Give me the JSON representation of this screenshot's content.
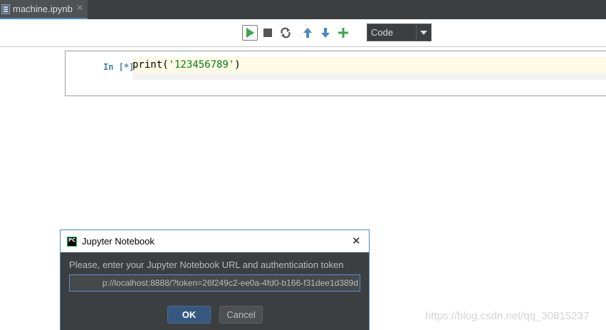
{
  "tab": {
    "title": "machine.ipynb",
    "close_glyph": "✕",
    "icon": "notebook-file-icon"
  },
  "toolbar": {
    "buttons": [
      {
        "name": "run-cell-button",
        "icon": "play-icon",
        "color": "#3fa34d"
      },
      {
        "name": "interrupt-button",
        "icon": "stop-icon",
        "color": "#555555"
      },
      {
        "name": "restart-kernel-button",
        "icon": "restart-icon",
        "color": "#555555"
      },
      {
        "name": "move-cell-up-button",
        "icon": "arrow-up-icon",
        "color": "#4a88c7"
      },
      {
        "name": "move-cell-down-button",
        "icon": "arrow-down-icon",
        "color": "#4a88c7"
      },
      {
        "name": "add-cell-button",
        "icon": "plus-icon",
        "color": "#3fa34d"
      }
    ],
    "cell_type": "Code"
  },
  "cell": {
    "prompt": "In [*]:",
    "code_prefix": "print(",
    "code_string": "'123456789'",
    "code_suffix": ")"
  },
  "dialog": {
    "title": "Jupyter Notebook",
    "close_glyph": "✕",
    "label": "Please, enter your Jupyter Notebook URL and authentication token",
    "input_value": "p://localhost:8888/?token=26f249c2-ee0a-4fd0-b166-f31dee1d389d",
    "ok_label": "OK",
    "cancel_label": "Cancel"
  },
  "watermark": "https://blog.csdn.net/qq_30815237",
  "colors": {
    "accent": "#4a88c7",
    "dark_bg": "#3c3f41",
    "ok_button": "#365880"
  }
}
